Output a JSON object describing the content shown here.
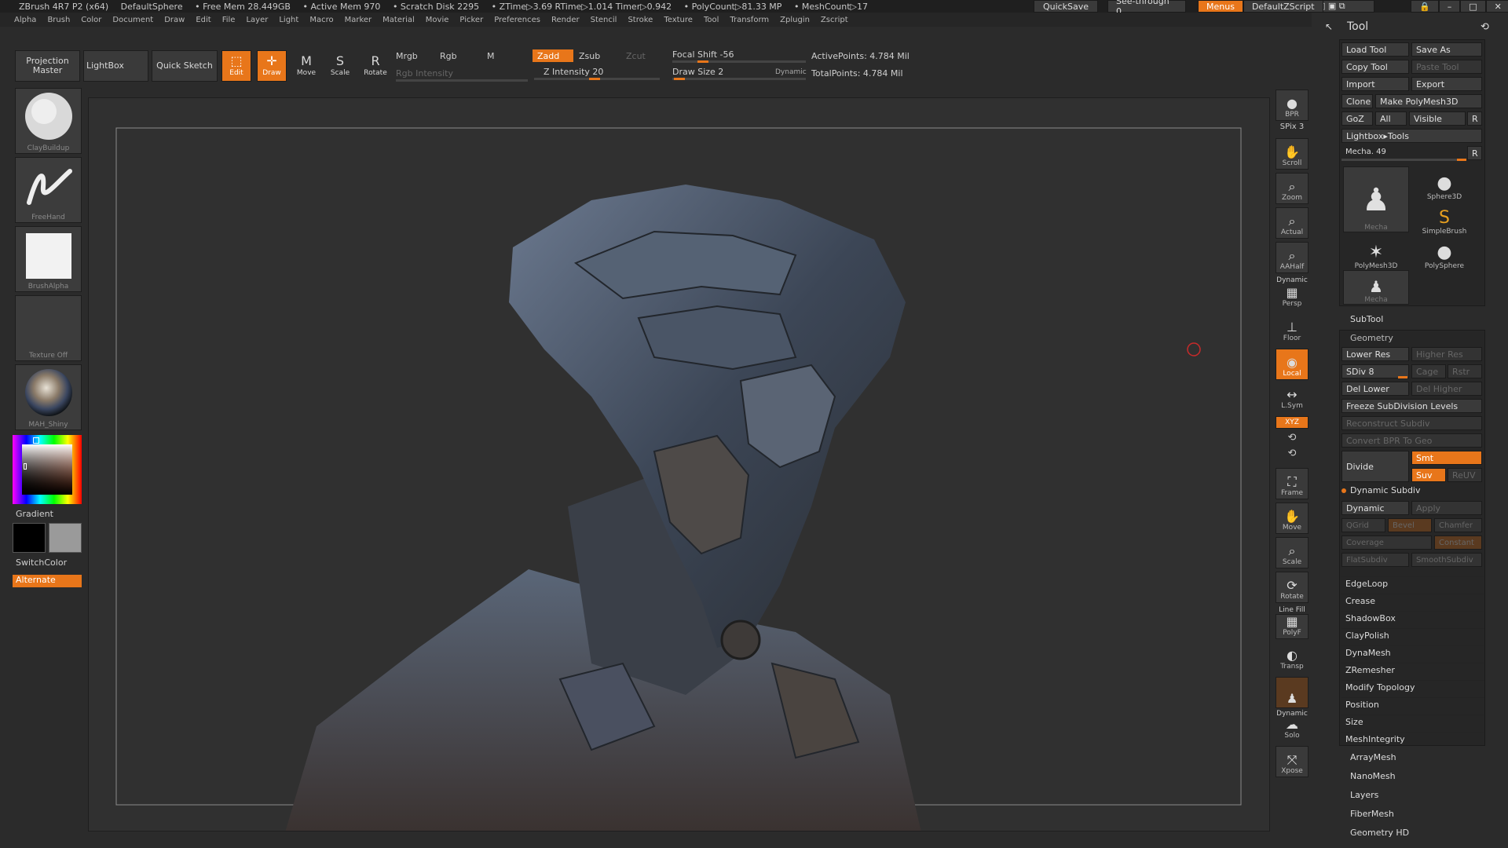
{
  "titlebar": {
    "app": "ZBrush 4R7 P2 (x64)",
    "tool": "DefaultSphere",
    "free_mem": "• Free Mem 28.449GB",
    "active_mem": "• Active Mem 970",
    "scratch": "• Scratch Disk 2295",
    "ztime": "• ZTime▷3.69 RTime▷1.014 Timer▷0.942",
    "polycount": "• PolyCount▷81.33 MP",
    "meshcount": "• MeshCount▷17",
    "quicksave": "QuickSave",
    "see_through": "See-through  0",
    "menus": "Menus",
    "script": "DefaultZScript"
  },
  "menubar": [
    "Alpha",
    "Brush",
    "Color",
    "Document",
    "Draw",
    "Edit",
    "File",
    "Layer",
    "Light",
    "Macro",
    "Marker",
    "Material",
    "Movie",
    "Picker",
    "Preferences",
    "Render",
    "Stencil",
    "Stroke",
    "Texture",
    "Tool",
    "Transform",
    "Zplugin",
    "Zscript"
  ],
  "toolbar": {
    "projection_master": "Projection Master",
    "lightbox": "LightBox",
    "quick_sketch": "Quick Sketch",
    "edit": "Edit",
    "draw": "Draw",
    "move": "Move",
    "scale": "Scale",
    "rotate": "Rotate",
    "mrgb": "Mrgb",
    "rgb": "Rgb",
    "m": "M",
    "rgb_intensity": "Rgb Intensity",
    "zadd": "Zadd",
    "zsub": "Zsub",
    "zcut": "Zcut",
    "z_intensity": "Z Intensity 20",
    "focal_shift": "Focal Shift -56",
    "draw_size": "Draw Size 2",
    "dynamic": "Dynamic",
    "active_points": "ActivePoints: 4.784 Mil",
    "total_points": "TotalPoints: 4.784 Mil"
  },
  "leftshelf": {
    "brush": "ClayBuildup",
    "stroke": "FreeHand",
    "alpha": "BrushAlpha",
    "texture": "Texture Off",
    "material": "MAH_Shiny",
    "gradient": "Gradient",
    "switch_color": "SwitchColor",
    "alternate": "Alternate"
  },
  "rightshelf": {
    "bpr": "BPR",
    "spix": "SPix 3",
    "scroll": "Scroll",
    "zoom": "Zoom",
    "actual": "Actual",
    "aahalf": "AAHalf",
    "dynamic": "Dynamic",
    "persp": "Persp",
    "floor": "Floor",
    "local": "Local",
    "lsym": "L.Sym",
    "xyz": "XYZ",
    "frame": "Frame",
    "move": "Move",
    "scale": "Scale",
    "rotate": "Rotate",
    "line_fill": "Line Fill",
    "polyf": "PolyF",
    "transp": "Transp",
    "dynamic2": "Dynamic",
    "solo": "Solo",
    "xpose": "Xpose"
  },
  "toolpanel": {
    "title": "Tool",
    "load_tool": "Load Tool",
    "save_as": "Save As",
    "copy_tool": "Copy Tool",
    "paste_tool": "Paste Tool",
    "import": "Import",
    "export": "Export",
    "clone": "Clone",
    "make_polymesh": "Make PolyMesh3D",
    "goz": "GoZ",
    "all": "All",
    "visible": "Visible",
    "r": "R",
    "lightbox_tools": "Lightbox▸Tools",
    "mecha_slider": "Mecha. 49",
    "r2": "R",
    "thumbs": [
      "Mecha",
      "Sphere3D",
      "SimpleBrush",
      "PolyMesh3D",
      "PolySphere",
      "Mecha"
    ],
    "subtool": "SubTool",
    "geometry": "Geometry",
    "lower_res": "Lower Res",
    "higher_res": "Higher Res",
    "sdiv": "SDiv 8",
    "cage": "Cage",
    "rstr": "Rstr",
    "del_lower": "Del Lower",
    "del_higher": "Del Higher",
    "freeze": "Freeze SubDivision Levels",
    "reconstruct": "Reconstruct Subdiv",
    "convert_bpr": "Convert BPR To Geo",
    "divide": "Divide",
    "smt": "Smt",
    "suv": "Suv",
    "reuv": "ReUV",
    "dynamic_subdiv": "Dynamic Subdiv",
    "dynamic": "Dynamic",
    "apply": "Apply",
    "qgrid": "QGrid",
    "bevel": "Bevel",
    "chamfer": "Chamfer",
    "coverage": "Coverage",
    "constant": "Constant",
    "flatsubdiv": "FlatSubdiv",
    "smoothsubdiv": "SmoothSubdiv",
    "sections": [
      "EdgeLoop",
      "Crease",
      "ShadowBox",
      "ClayPolish",
      "DynaMesh",
      "ZRemesher",
      "Modify Topology",
      "Position",
      "Size",
      "MeshIntegrity"
    ],
    "sections2": [
      "ArrayMesh",
      "NanoMesh",
      "Layers",
      "FiberMesh",
      "Geometry HD"
    ]
  },
  "colors": {
    "accent": "#e8761a",
    "bg": "#2b2b2b",
    "viewport": "#303030"
  }
}
